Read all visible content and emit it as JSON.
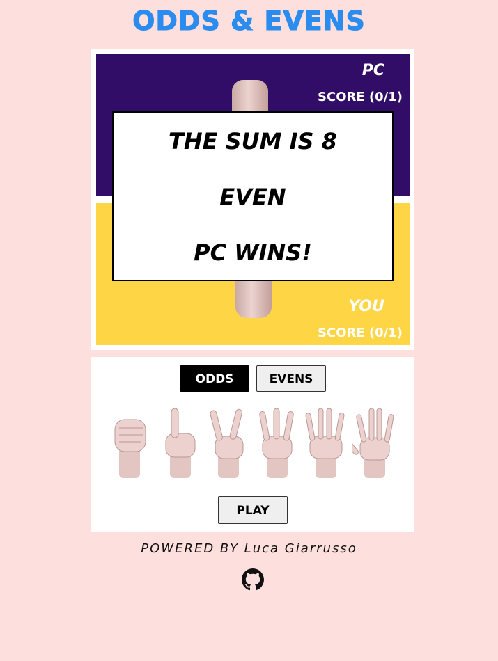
{
  "title": "ODDS & EVENS",
  "board": {
    "pc": {
      "label": "PC",
      "score": "SCORE (0/1)",
      "color": "#310d68"
    },
    "you": {
      "label": "YOU",
      "score": "SCORE (0/1)",
      "color": "#fed544"
    },
    "result": {
      "sum_text": "THE SUM IS 8",
      "parity": "EVEN",
      "winner": "PC WINS!"
    }
  },
  "controls": {
    "odds_label": "ODDS",
    "evens_label": "EVENS",
    "selected": "ODDS",
    "play_label": "PLAY",
    "hands": [
      {
        "fingers": 0,
        "icon": "fist-hand-icon"
      },
      {
        "fingers": 1,
        "icon": "one-finger-hand-icon"
      },
      {
        "fingers": 2,
        "icon": "two-fingers-hand-icon"
      },
      {
        "fingers": 3,
        "icon": "three-fingers-hand-icon"
      },
      {
        "fingers": 4,
        "icon": "four-fingers-hand-icon"
      },
      {
        "fingers": 5,
        "icon": "five-fingers-hand-icon"
      }
    ]
  },
  "footer": {
    "powered_by": "POWERED BY Luca Giarrusso",
    "github_icon": "github-icon"
  },
  "colors": {
    "background": "#fde0dd",
    "title": "#2b8cf0",
    "selected_button": "#000000"
  }
}
